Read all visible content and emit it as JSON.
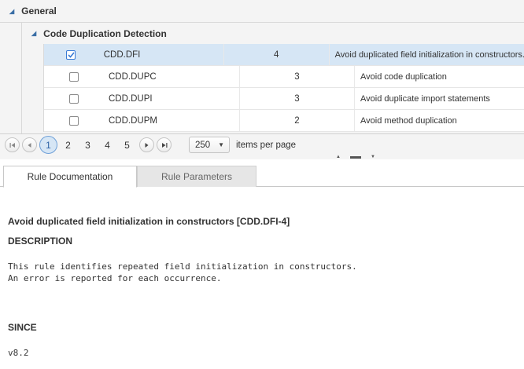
{
  "tree": {
    "group_label": "General",
    "subgroup_label": "Code Duplication Detection",
    "rows": [
      {
        "checked": true,
        "id": "CDD.DFI",
        "severity": "4",
        "description": "Avoid duplicated field initialization in constructors.",
        "selected": true
      },
      {
        "checked": false,
        "id": "CDD.DUPC",
        "severity": "3",
        "description": "Avoid code duplication",
        "selected": false
      },
      {
        "checked": false,
        "id": "CDD.DUPI",
        "severity": "3",
        "description": "Avoid duplicate import statements",
        "selected": false
      },
      {
        "checked": false,
        "id": "CDD.DUPM",
        "severity": "2",
        "description": "Avoid method duplication",
        "selected": false
      }
    ]
  },
  "pager": {
    "pages": [
      "1",
      "2",
      "3",
      "4",
      "5"
    ],
    "current_page": "1",
    "page_size": "250",
    "items_per_page_label": "items per page"
  },
  "tabs": {
    "documentation": "Rule Documentation",
    "parameters": "Rule Parameters"
  },
  "doc": {
    "title": "Avoid duplicated field initialization in constructors [CDD.DFI-4]",
    "description_heading": "DESCRIPTION",
    "description_line1": "This rule identifies repeated field initialization in constructors.",
    "description_line2": "An error is reported for each occurrence.",
    "since_heading": "SINCE",
    "since_value": "v8.2"
  },
  "colors": {
    "selected_row": "#d6e6f5",
    "accent": "#3a7bd5",
    "panel_bg": "#f4f4f4"
  }
}
